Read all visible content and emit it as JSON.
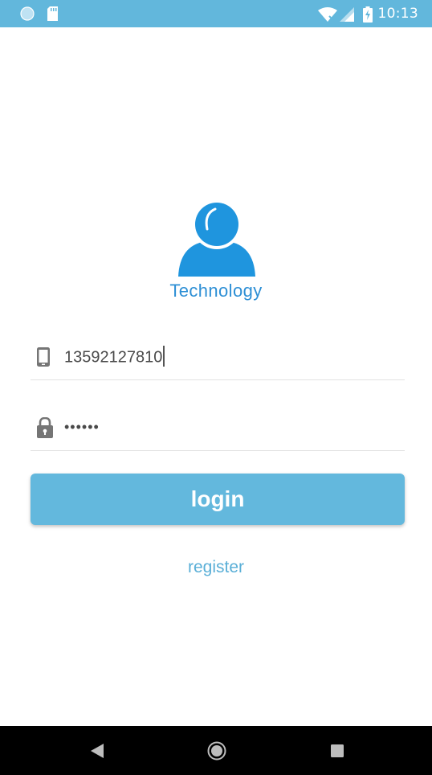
{
  "status_bar": {
    "time": "10:13",
    "background_color": "#62b7dc",
    "icons": [
      "circle-notification-icon",
      "sd-card-icon",
      "wifi-icon",
      "cellular-signal-icon",
      "battery-charging-icon"
    ]
  },
  "logo": {
    "icon": "user-avatar-icon",
    "title": "Technology",
    "color": "#2d8fd5"
  },
  "form": {
    "phone": {
      "icon": "phone-icon",
      "value": "13592127810"
    },
    "password": {
      "icon": "lock-icon",
      "masked_value": "••••••"
    },
    "login_label": "login",
    "register_label": "register"
  },
  "navigation": {
    "buttons": [
      "back-icon",
      "home-icon",
      "recents-icon"
    ]
  }
}
